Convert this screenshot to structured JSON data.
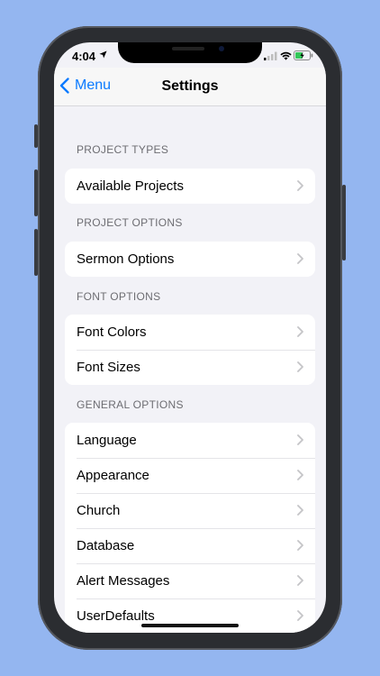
{
  "status": {
    "time": "4:04"
  },
  "nav": {
    "back_label": "Menu",
    "title": "Settings"
  },
  "sections": [
    {
      "header": "PROJECT TYPES",
      "items": [
        "Available Projects"
      ]
    },
    {
      "header": "PROJECT OPTIONS",
      "items": [
        "Sermon Options"
      ]
    },
    {
      "header": "FONT OPTIONS",
      "items": [
        "Font Colors",
        "Font Sizes"
      ]
    },
    {
      "header": "GENERAL OPTIONS",
      "items": [
        "Language",
        "Appearance",
        "Church",
        "Database",
        "Alert Messages",
        "UserDefaults"
      ]
    }
  ],
  "colors": {
    "background": "#94b6f0",
    "accent": "#0a7aff",
    "grouped_bg": "#f2f2f7"
  }
}
